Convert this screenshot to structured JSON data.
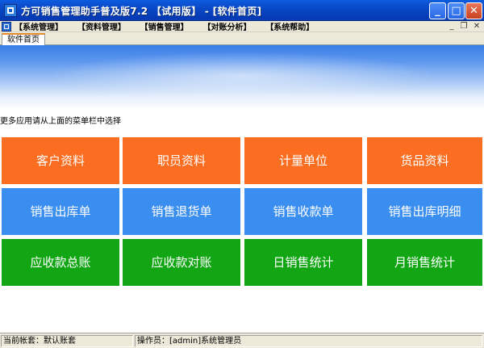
{
  "window": {
    "title": "方可销售管理助手普及版7.2 【试用版】 - [软件首页]",
    "controls": {
      "minimize": "_",
      "maximize": "□",
      "close": "✕"
    }
  },
  "menu": {
    "items": [
      "【系统管理】",
      "【资料管理】",
      "【销售管理】",
      "【对账分析】",
      "【系统帮助】"
    ],
    "mdi_controls": {
      "minimize": "_",
      "restore": "❐",
      "close": "✕"
    }
  },
  "tabs": [
    {
      "label": "软件首页",
      "active": true
    }
  ],
  "hint": "更多应用请从上面的菜单栏中选择",
  "tiles": [
    {
      "label": "客户资料",
      "color": "#fb6d20"
    },
    {
      "label": "职员资料",
      "color": "#fb6d20"
    },
    {
      "label": "计量单位",
      "color": "#fb6d20"
    },
    {
      "label": "货品资料",
      "color": "#fb6d20"
    },
    {
      "label": "销售出库单",
      "color": "#3a8ef0"
    },
    {
      "label": "销售退货单",
      "color": "#3a8ef0"
    },
    {
      "label": "销售收款单",
      "color": "#3a8ef0"
    },
    {
      "label": "销售出库明细",
      "color": "#3a8ef0"
    },
    {
      "label": "应收款总账",
      "color": "#12a514"
    },
    {
      "label": "应收款对账",
      "color": "#12a514"
    },
    {
      "label": "日销售统计",
      "color": "#12a514"
    },
    {
      "label": "月销售统计",
      "color": "#12a514"
    }
  ],
  "status": {
    "account": "当前帐套：默认账套",
    "operator": "操作员：[admin]系统管理员"
  }
}
